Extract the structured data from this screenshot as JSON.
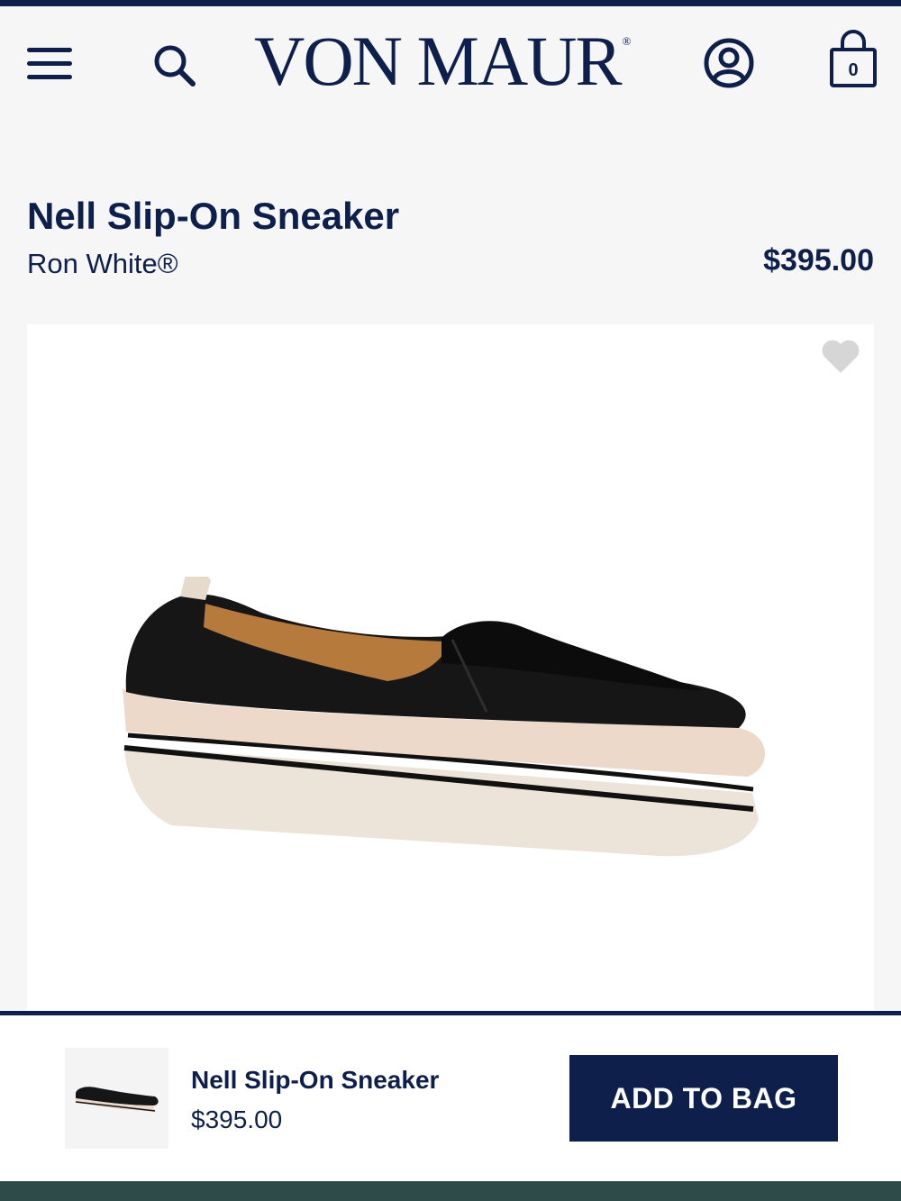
{
  "header": {
    "logo_text": "VON MAUR",
    "logo_mark": "®",
    "bag_count": "0",
    "icons": [
      "hamburger-menu-icon",
      "search-icon",
      "account-icon",
      "shopping-bag-icon"
    ]
  },
  "product": {
    "title": "Nell Slip-On Sneaker",
    "brand": "Ron White®",
    "price": "$395.00",
    "image_icon": "heart-icon"
  },
  "sticky_bar": {
    "title": "Nell Slip-On Sneaker",
    "price": "$395.00",
    "add_button_label": "ADD TO BAG"
  },
  "colors": {
    "brand_navy": "#0d1f4a",
    "page_bg": "#f6f6f7",
    "footer_green": "#2e4a49"
  }
}
